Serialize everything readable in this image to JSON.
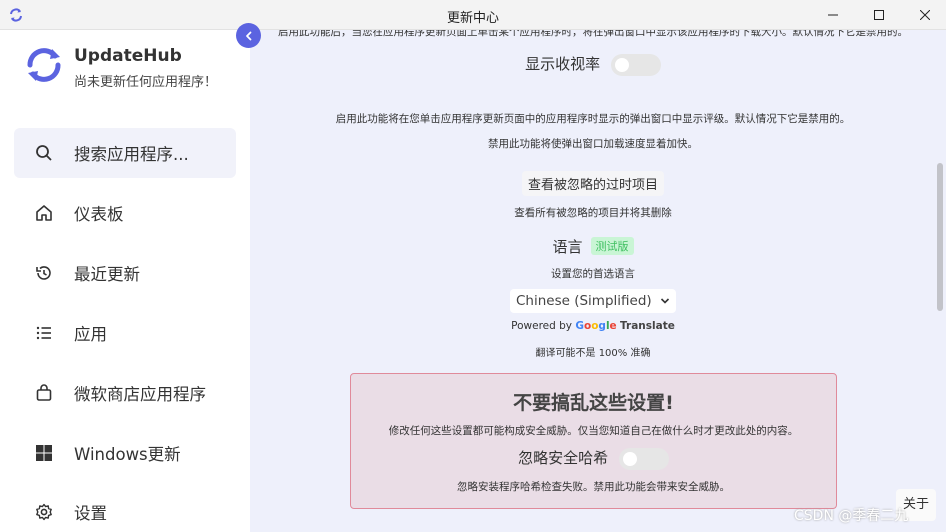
{
  "window": {
    "title": "更新中心"
  },
  "sidebar": {
    "app_name": "UpdateHub",
    "app_subtitle": "尚未更新任何应用程序！",
    "search_label": "搜索应用程序...",
    "items": [
      {
        "label": "仪表板",
        "icon": "home-icon"
      },
      {
        "label": "最近更新",
        "icon": "history-icon"
      },
      {
        "label": "应用",
        "icon": "list-icon"
      },
      {
        "label": "微软商店应用程序",
        "icon": "store-bag-icon"
      },
      {
        "label": "Windows更新",
        "icon": "windows-logo-icon"
      },
      {
        "label": "设置",
        "icon": "gear-icon"
      }
    ]
  },
  "settings": {
    "cut_top_text": "启用此功能后，当您在应用程序更新页面上单击某个应用程序时，将在弹出窗口中显示该应用程序的下载大小。默认情况下它是禁用的。",
    "ratings_label": "显示收视率",
    "ratings_desc1": "启用此功能将在您单击应用程序更新页面中的应用程序时显示的弹出窗口中显示评级。默认情况下它是禁用的。",
    "ratings_desc2": "禁用此功能将使弹出窗口加载速度显着加快。",
    "ignored_button": "查看被忽略的过时项目",
    "ignored_desc": "查看所有被忽略的项目并将其删除",
    "language_label": "语言",
    "language_badge": "测试版",
    "language_desc": "设置您的首选语言",
    "language_value": "Chinese (Simplified)",
    "powered_by": "Powered by",
    "google": "Google",
    "translate": "Translate",
    "translation_note": "翻译可能不是 100% 准确"
  },
  "danger": {
    "title": "不要搞乱这些设置!",
    "desc": "修改任何这些设置都可能构成安全威胁。仅当您知道自己在做什么时才更改此处的内容。",
    "hash_label": "忽略安全哈希",
    "hash_desc": "忽略安装程序哈希检查失败。禁用此功能会带来安全威胁。"
  },
  "about_button": "关于",
  "watermark": "CSDN @季春二九",
  "colors": {
    "accent": "#5b63e0",
    "badge_bg": "#c9f5d5",
    "badge_fg": "#3fbf60",
    "danger_border": "#e08a9a"
  }
}
